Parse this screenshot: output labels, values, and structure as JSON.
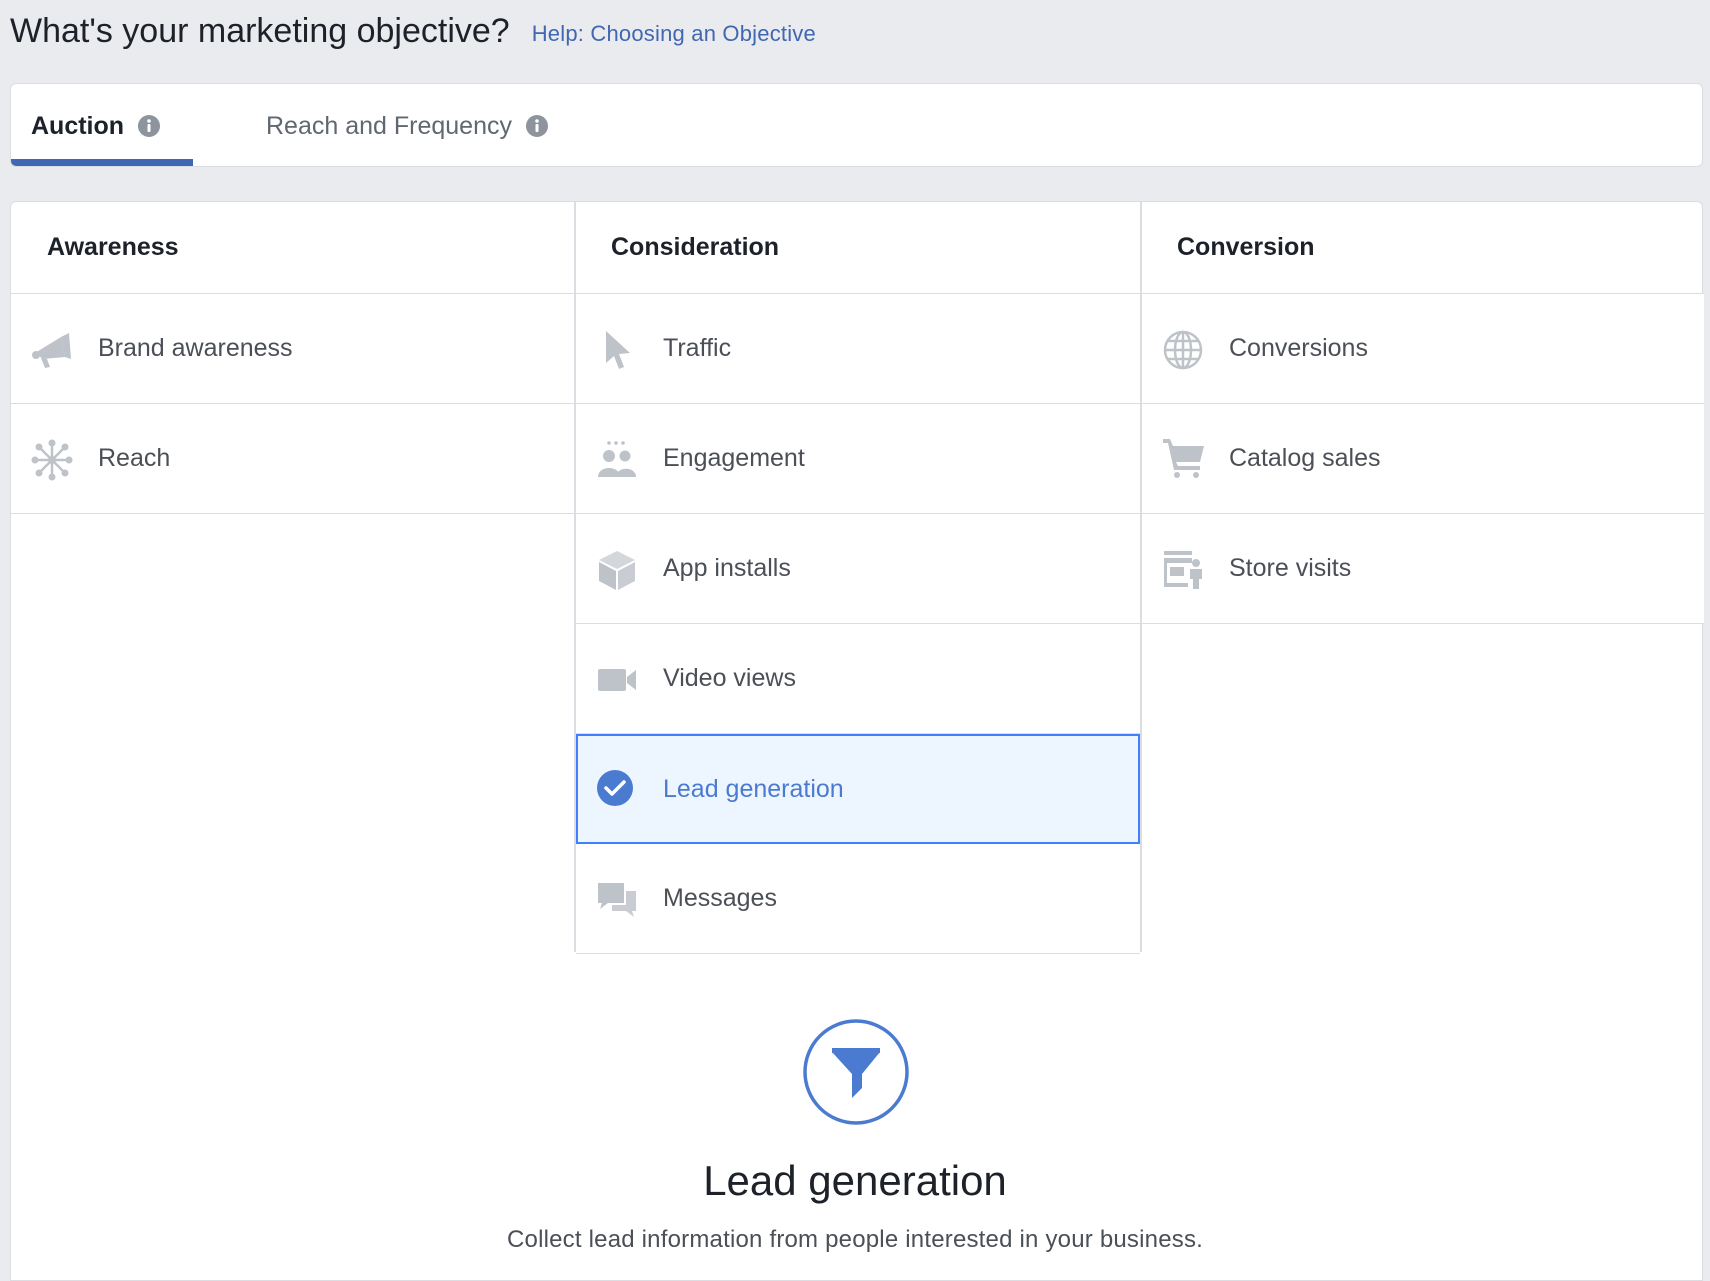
{
  "header": {
    "title": "What's your marketing objective?",
    "help_link": "Help: Choosing an Objective"
  },
  "tabs": [
    {
      "label": "Auction",
      "active": true,
      "icon": "info-icon"
    },
    {
      "label": "Reach and Frequency",
      "active": false,
      "icon": "info-icon"
    }
  ],
  "columns": [
    {
      "heading": "Awareness",
      "items": [
        {
          "label": "Brand awareness",
          "icon": "megaphone-icon"
        },
        {
          "label": "Reach",
          "icon": "reach-network-icon"
        }
      ]
    },
    {
      "heading": "Consideration",
      "items": [
        {
          "label": "Traffic",
          "icon": "cursor-icon"
        },
        {
          "label": "Engagement",
          "icon": "people-icon"
        },
        {
          "label": "App installs",
          "icon": "box-icon"
        },
        {
          "label": "Video views",
          "icon": "video-camera-icon"
        },
        {
          "label": "Lead generation",
          "icon": "check-circle-icon",
          "selected": true
        },
        {
          "label": "Messages",
          "icon": "chat-bubbles-icon"
        }
      ]
    },
    {
      "heading": "Conversion",
      "items": [
        {
          "label": "Conversions",
          "icon": "globe-icon"
        },
        {
          "label": "Catalog sales",
          "icon": "shopping-cart-icon"
        },
        {
          "label": "Store visits",
          "icon": "store-icon"
        }
      ]
    }
  ],
  "detail": {
    "icon": "funnel-icon",
    "title": "Lead generation",
    "description": "Collect lead information from people interested in your business."
  },
  "colors": {
    "accent": "#4267b2",
    "selected_border": "#4080ff",
    "selected_bg": "#edf5fe",
    "icon_gray": "#bec3c9",
    "background": "#e9ebee"
  }
}
